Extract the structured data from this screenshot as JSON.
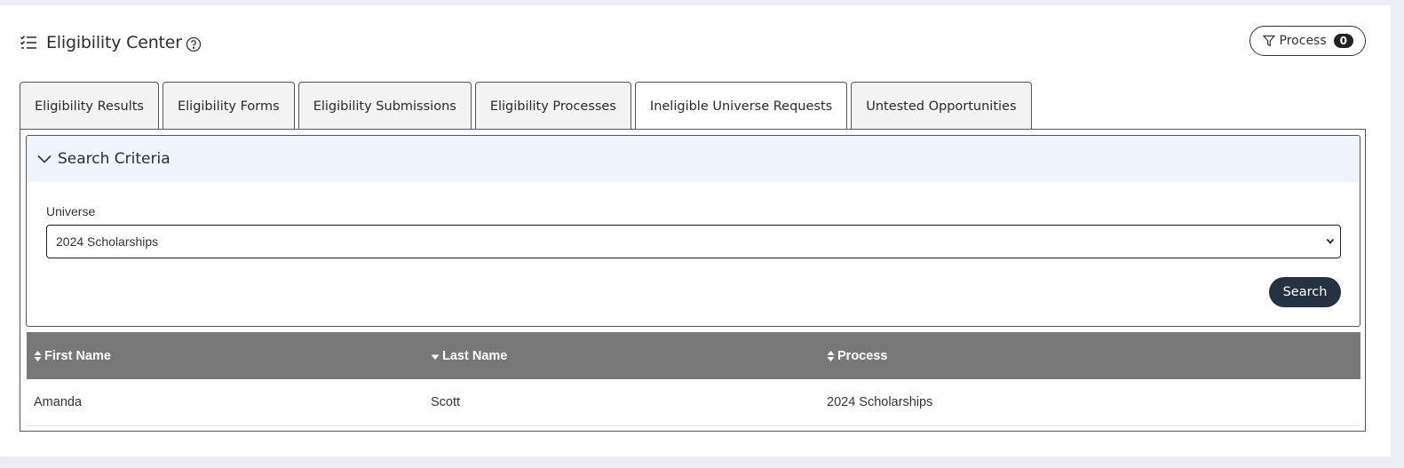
{
  "header": {
    "title": "Eligibility Center",
    "process_label": "Process",
    "process_count": "0"
  },
  "tabs": [
    {
      "label": "Eligibility Results",
      "active": false
    },
    {
      "label": "Eligibility Forms",
      "active": false
    },
    {
      "label": "Eligibility Submissions",
      "active": false
    },
    {
      "label": "Eligibility Processes",
      "active": false
    },
    {
      "label": "Ineligible Universe Requests",
      "active": true
    },
    {
      "label": "Untested Opportunities",
      "active": false
    }
  ],
  "search": {
    "title": "Search Criteria",
    "universe_label": "Universe",
    "universe_value": "2024 Scholarships",
    "button_label": "Search"
  },
  "table": {
    "columns": [
      "First Name",
      "Last Name",
      "Process"
    ],
    "rows": [
      [
        "Amanda",
        "Scott",
        "2024 Scholarships"
      ]
    ]
  },
  "colors": {
    "page_bg": "#eceef4",
    "criteria_header_bg": "#eef5fc",
    "table_header_bg": "#787878",
    "primary_button": "#253241"
  }
}
